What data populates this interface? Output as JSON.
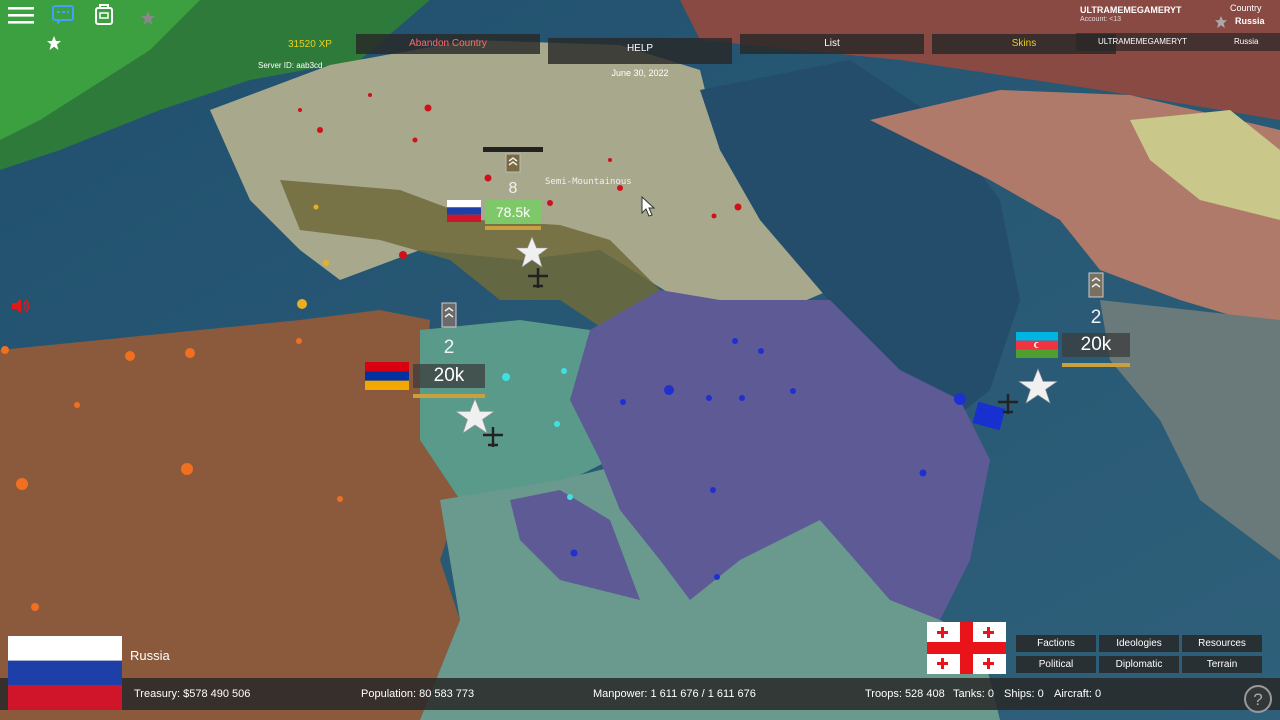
{
  "topbar": {
    "xp": "31520 XP",
    "server_id": "Server ID: aab3cd",
    "abandon_label": "Abandon Country",
    "help_label": "HELP",
    "date": "June 30, 2022",
    "list_label": "List",
    "skins_label": "Skins",
    "player_name": "ULTRAMEMEGAMERYT",
    "player_name_top": "ULTRAMEMEGAMERYT",
    "account_age": "Account: <13",
    "country_heading": "Country",
    "country_name_top": "Russia",
    "country_name": "Russia"
  },
  "map": {
    "terrain_label": "Semi-Mountainous",
    "units": [
      {
        "country": "Russia",
        "count": "8",
        "strength": "78.5k",
        "strength_color": "#7ec86a"
      },
      {
        "country": "Armenia",
        "count": "2",
        "strength": "20k",
        "strength_color": "#505050"
      },
      {
        "country": "Azerbaijan",
        "count": "2",
        "strength": "20k",
        "strength_color": "#505050"
      }
    ]
  },
  "selected_country": {
    "name": "Russia",
    "flag_colors": [
      "#ffffff",
      "#1c3fa8",
      "#d0142a"
    ]
  },
  "hover_country_flag": {
    "colors": [
      "#ffffff",
      "#e8141a"
    ]
  },
  "tabs": {
    "factions": "Factions",
    "ideologies": "Ideologies",
    "resources": "Resources",
    "political": "Political",
    "diplomatic": "Diplomatic",
    "terrain": "Terrain"
  },
  "stats": {
    "treasury": "Treasury:  $578 490 506",
    "population": "Population: 80 583 773",
    "manpower": "Manpower:  1 611 676  /  1 611 676",
    "troops": "Troops: 528 408",
    "tanks": "Tanks: 0",
    "ships": "Ships: 0",
    "aircraft": "Aircraft: 0"
  },
  "icons": [
    "menu-icon",
    "chat-icon",
    "backpack-icon",
    "star-icon",
    "speaker-icon",
    "help-icon",
    "cursor-icon"
  ],
  "colors": {
    "russia_territory": "#b8ad8a",
    "armenia_territory": "#5f9a8c",
    "azerbaijan_territory": "#5d5a95",
    "turkey_territory": "#8c5a3e",
    "sea": "#2e5a78",
    "xp_color": "#e8d020",
    "abandon_color": "#ff6a6a",
    "skins_color": "#e8d020"
  }
}
